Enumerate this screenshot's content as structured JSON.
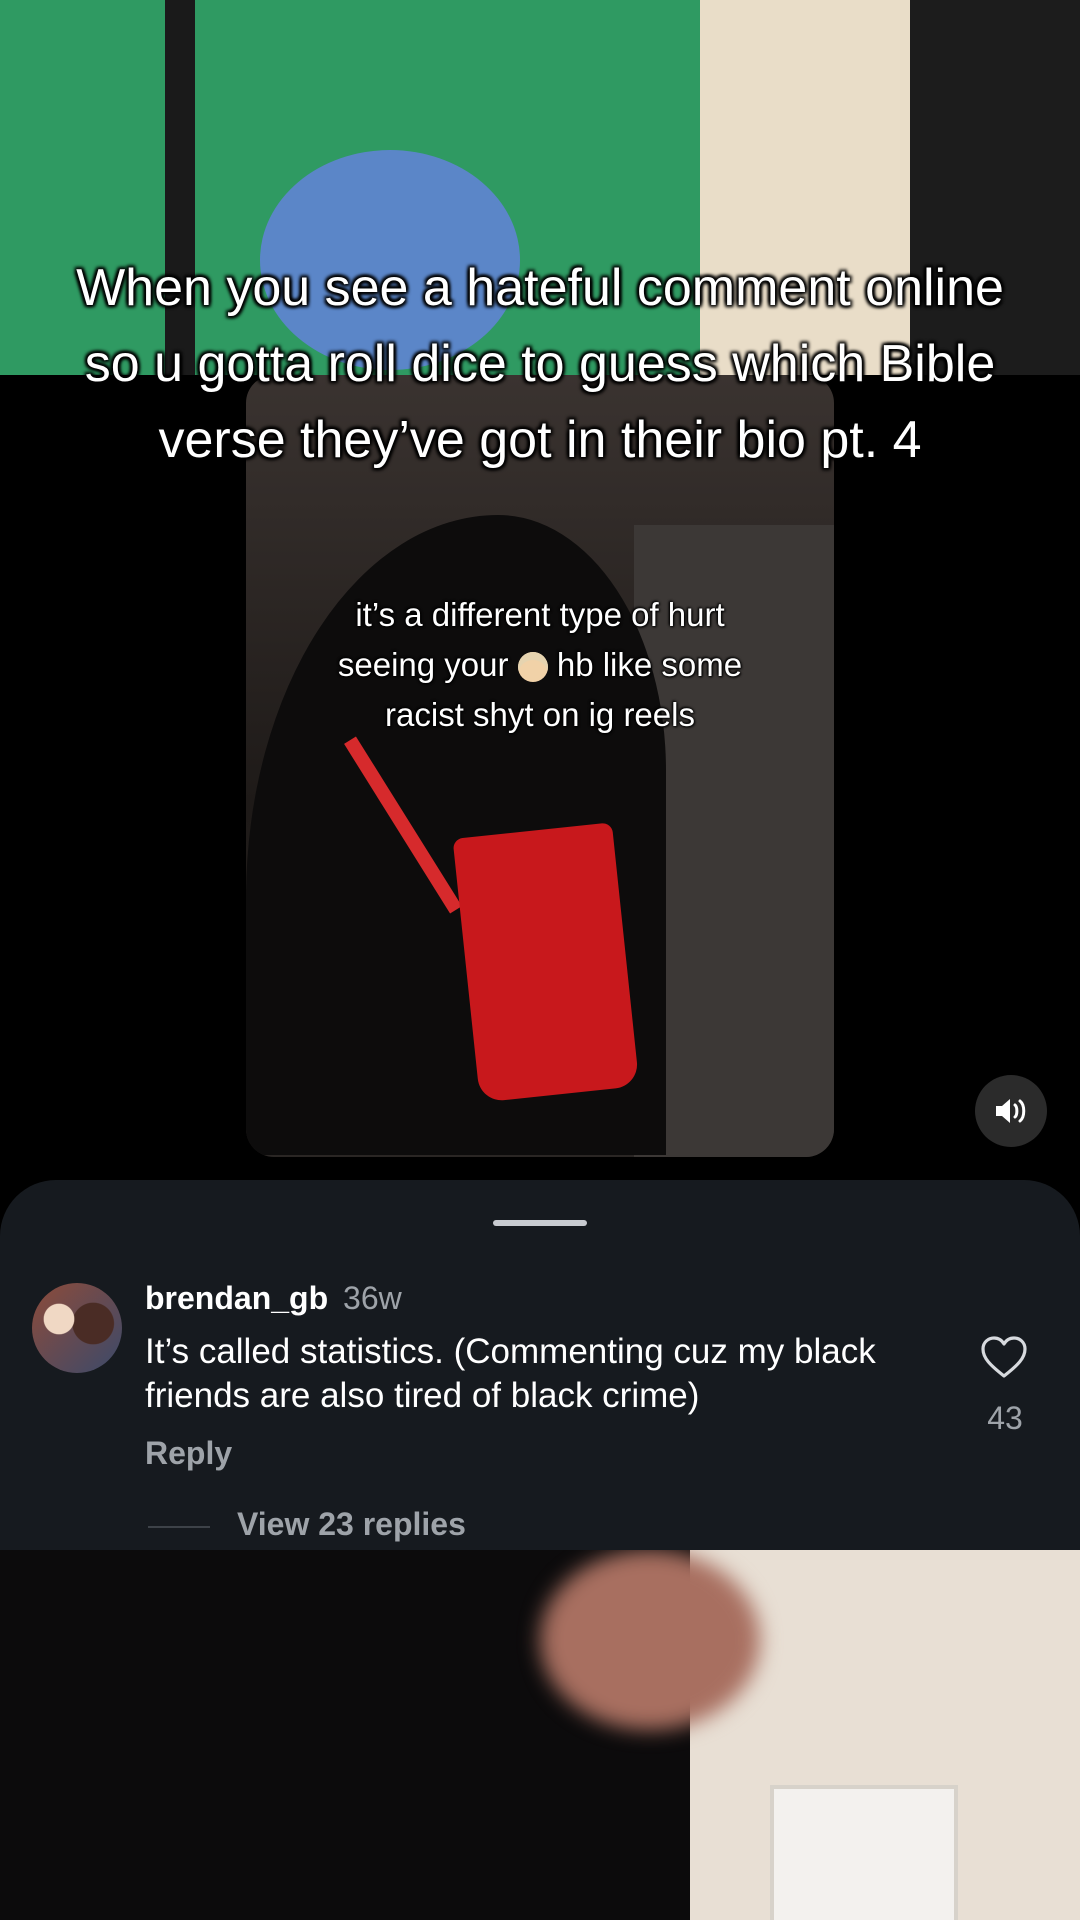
{
  "video": {
    "title_text": "When you see a hateful comment online so u gotta roll dice to guess which Bible verse they’ve got in their bio pt. 4"
  },
  "reel": {
    "caption_line1": "it’s a different type of hurt",
    "caption_line2_before": "seeing your",
    "caption_line2_after": "hb like some",
    "caption_line3": "racist shyt on ig reels"
  },
  "controls": {
    "sound_icon": "speaker-icon"
  },
  "comment_sheet": {
    "username": "brendan_gb",
    "time": "36w",
    "text": "It’s called statistics. (Commenting cuz my black friends are also tired of black crime)",
    "reply_label": "Reply",
    "likes": "43",
    "view_replies": "View 23 replies",
    "heart_icon": "heart-icon"
  },
  "colors": {
    "sheet_bg": "#161a1f",
    "muted_text": "#9ea3a9",
    "text": "#ffffff"
  }
}
